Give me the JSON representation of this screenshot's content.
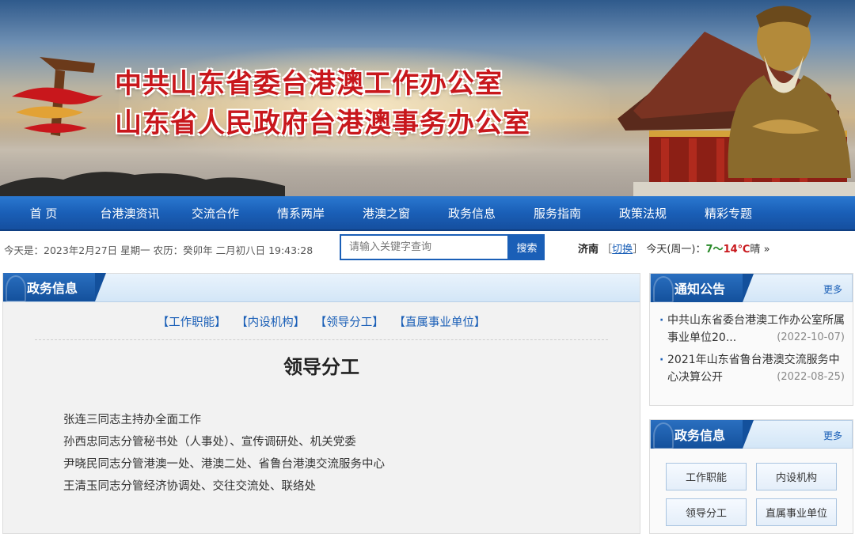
{
  "banner": {
    "title_line1": "中共山东省委台港澳工作办公室",
    "title_line2": "山东省人民政府台港澳事务办公室"
  },
  "nav": {
    "items": [
      "首 页",
      "台港澳资讯",
      "交流合作",
      "情系两岸",
      "港澳之窗",
      "政务信息",
      "服务指南",
      "政策法规",
      "精彩专题"
    ]
  },
  "infobar": {
    "date_text": "今天是：2023年2月27日 星期一 农历：癸卯年 二月初八日 19:43:28",
    "search_placeholder": "请输入关键字查询",
    "search_button": "搜索",
    "weather_city": "济南",
    "weather_switch": "切换",
    "weather_today": "今天(周一)：",
    "weather_low": "7",
    "weather_sep": "～",
    "weather_high": "14℃",
    "weather_cond": "晴",
    "weather_arrow": "»"
  },
  "main": {
    "section_title": "政务信息",
    "subnav": [
      "【工作职能】",
      "【内设机构】",
      "【领导分工】",
      "【直属事业单位】"
    ],
    "page_title": "领导分工",
    "paragraphs": [
      "张连三同志主持办全面工作",
      "孙西忠同志分管秘书处（人事处）、宣传调研处、机关党委",
      "尹晓民同志分管港澳一处、港澳二处、省鲁台港澳交流服务中心",
      "王清玉同志分管经济协调处、交往交流处、联络处"
    ]
  },
  "notice": {
    "title": "通知公告",
    "more": "更多",
    "items": [
      {
        "text": "中共山东省委台港澳工作办公室所属事业单位20...",
        "date": "(2022-10-07)"
      },
      {
        "text": "2021年山东省鲁台港澳交流服务中心决算公开",
        "date": "(2022-08-25)"
      }
    ]
  },
  "gov": {
    "title": "政务信息",
    "more": "更多",
    "buttons": [
      "工作职能",
      "内设机构",
      "领导分工",
      "直属事业单位"
    ]
  },
  "colors": {
    "nav_blue": "#1a5fb7",
    "title_red": "#c8171c",
    "temp_low_green": "#2a8a2a",
    "temp_high_red": "#c8171c"
  }
}
